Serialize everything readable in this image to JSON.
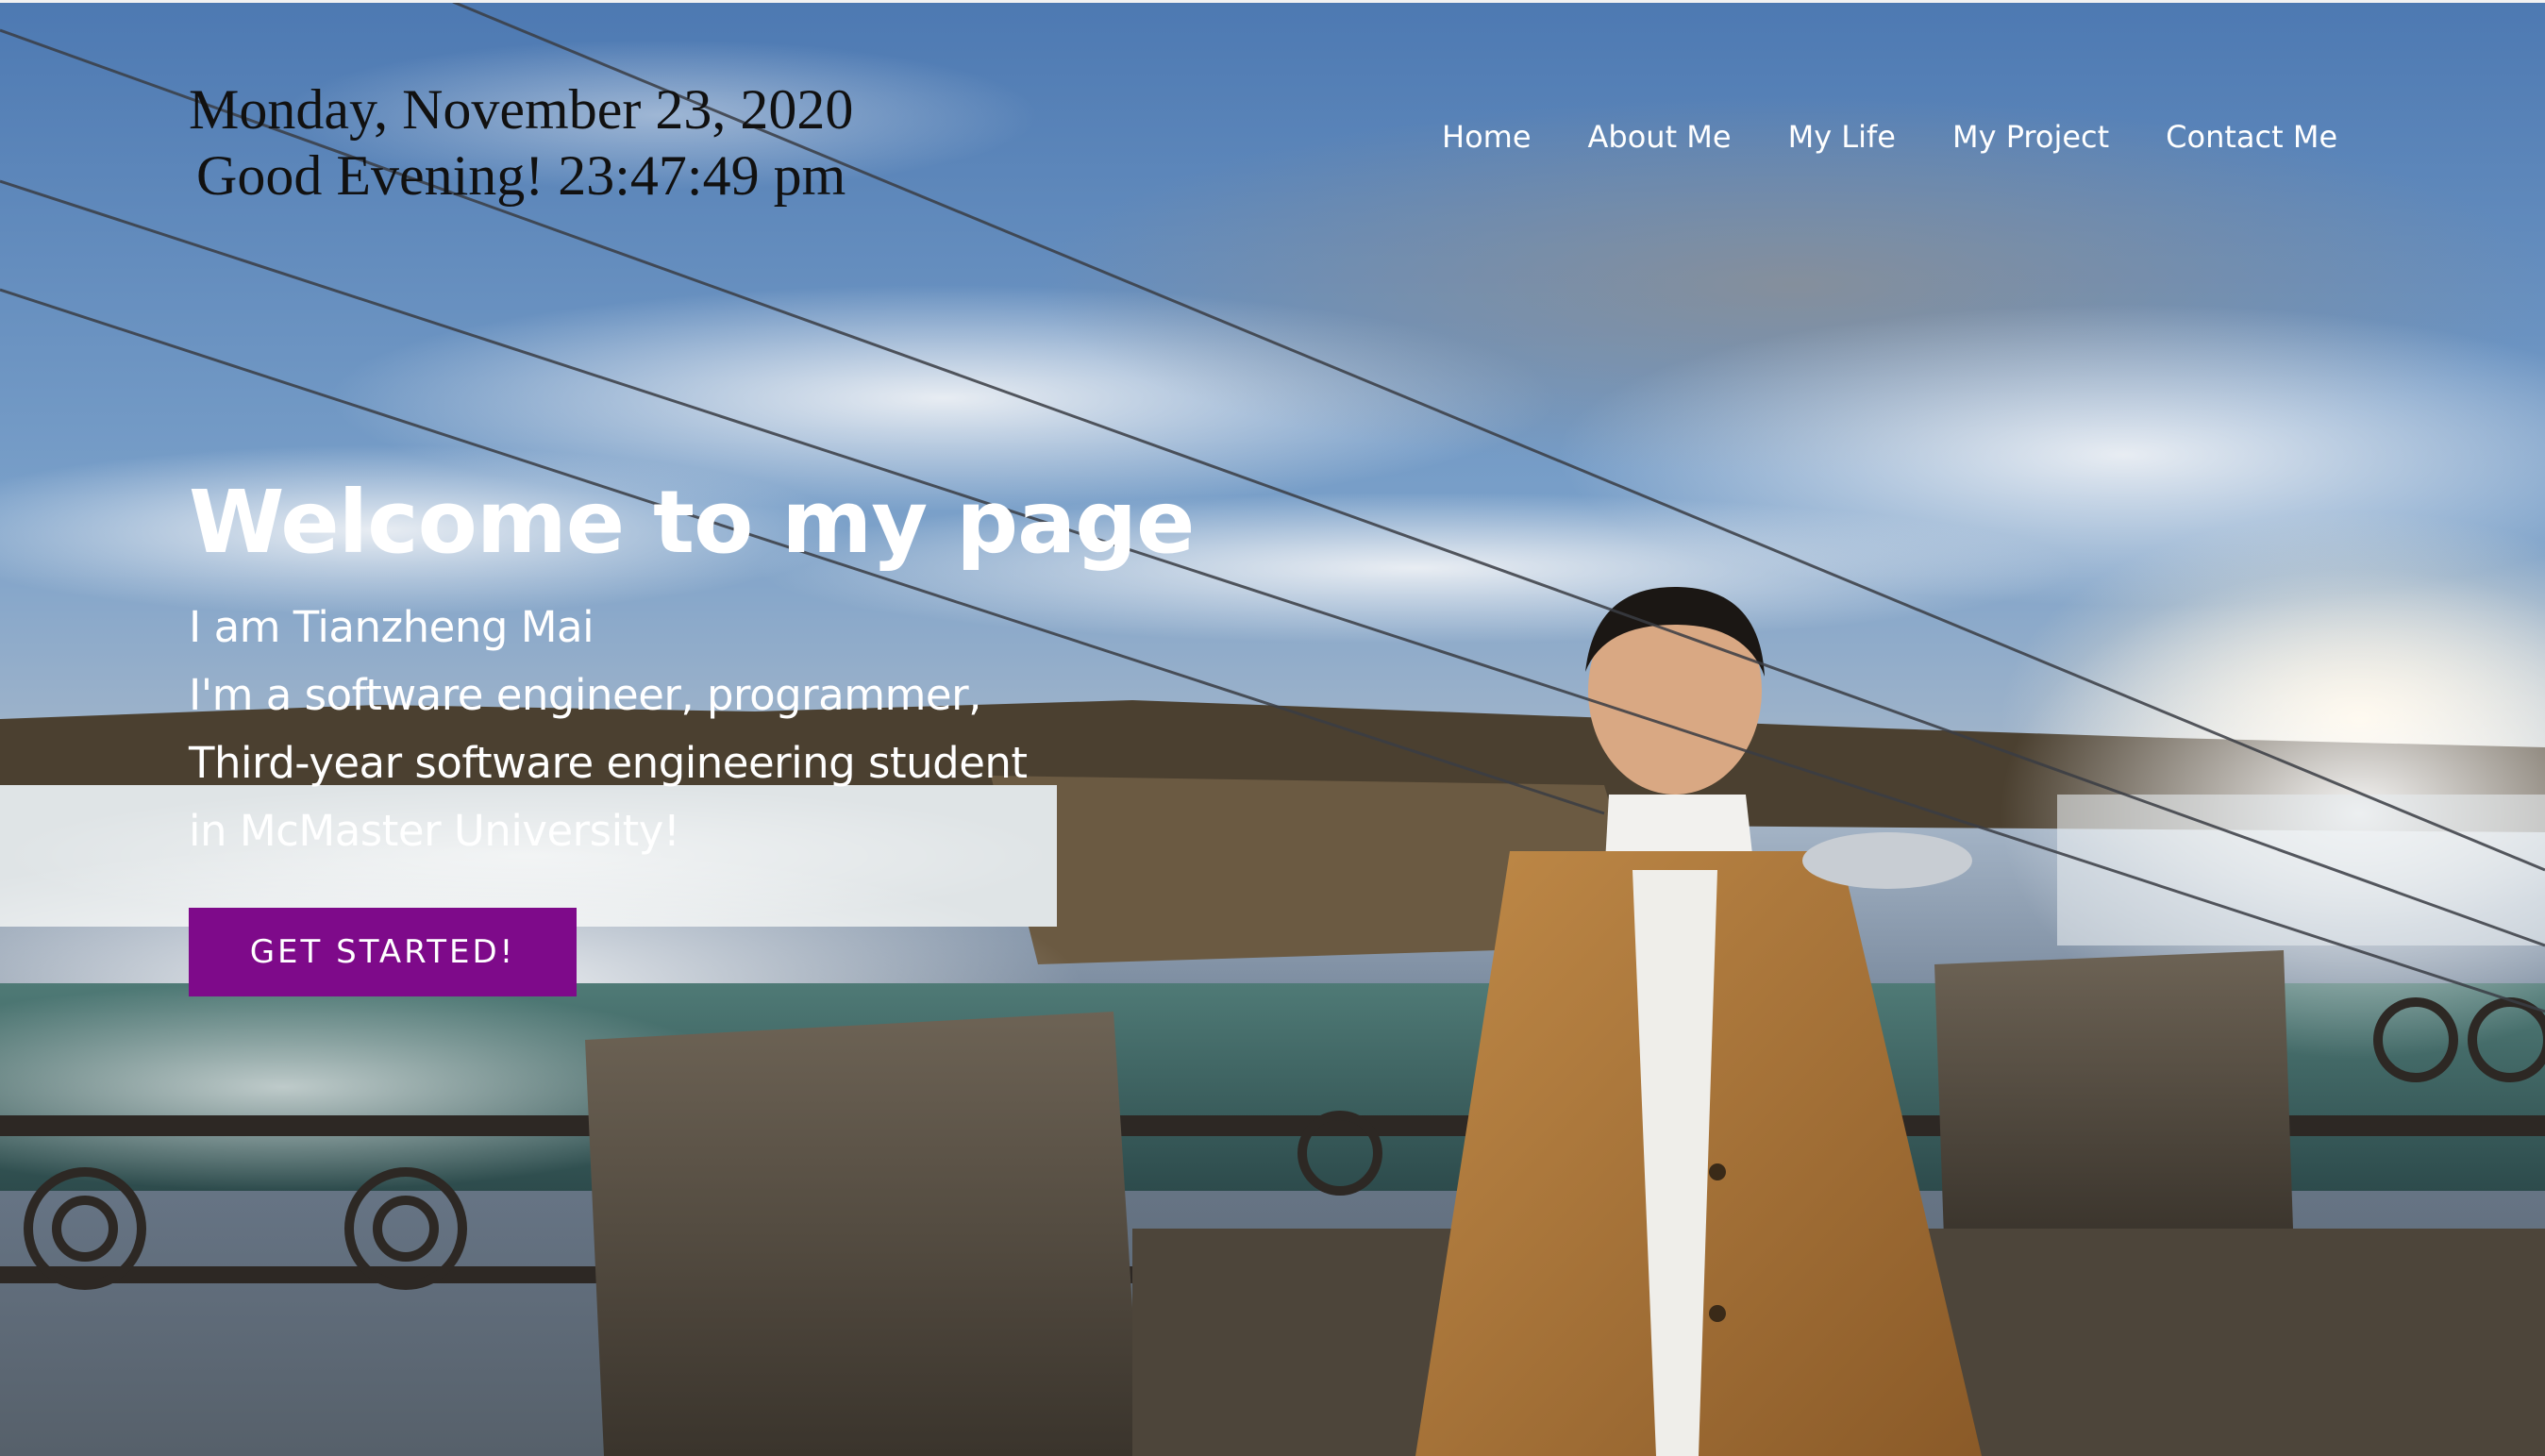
{
  "clock": {
    "date": "Monday, November 23, 2020",
    "greeting": "Good Evening! 23:47:49 pm"
  },
  "nav": {
    "items": [
      {
        "label": "Home"
      },
      {
        "label": "About Me"
      },
      {
        "label": "My Life"
      },
      {
        "label": "My Project"
      },
      {
        "label": "Contact Me"
      }
    ]
  },
  "hero": {
    "title": "Welcome to my page",
    "lines": [
      "I am Tianzheng Mai",
      "I'm a software engineer, programmer,",
      "Third-year software engineering student",
      "in McMaster University!"
    ],
    "cta_label": "GET STARTED!",
    "background": "photo-of-person-at-niagara-falls"
  },
  "colors": {
    "accent": "#7e0a8a",
    "text_light": "#ffffff",
    "clock_text": "#111111"
  }
}
